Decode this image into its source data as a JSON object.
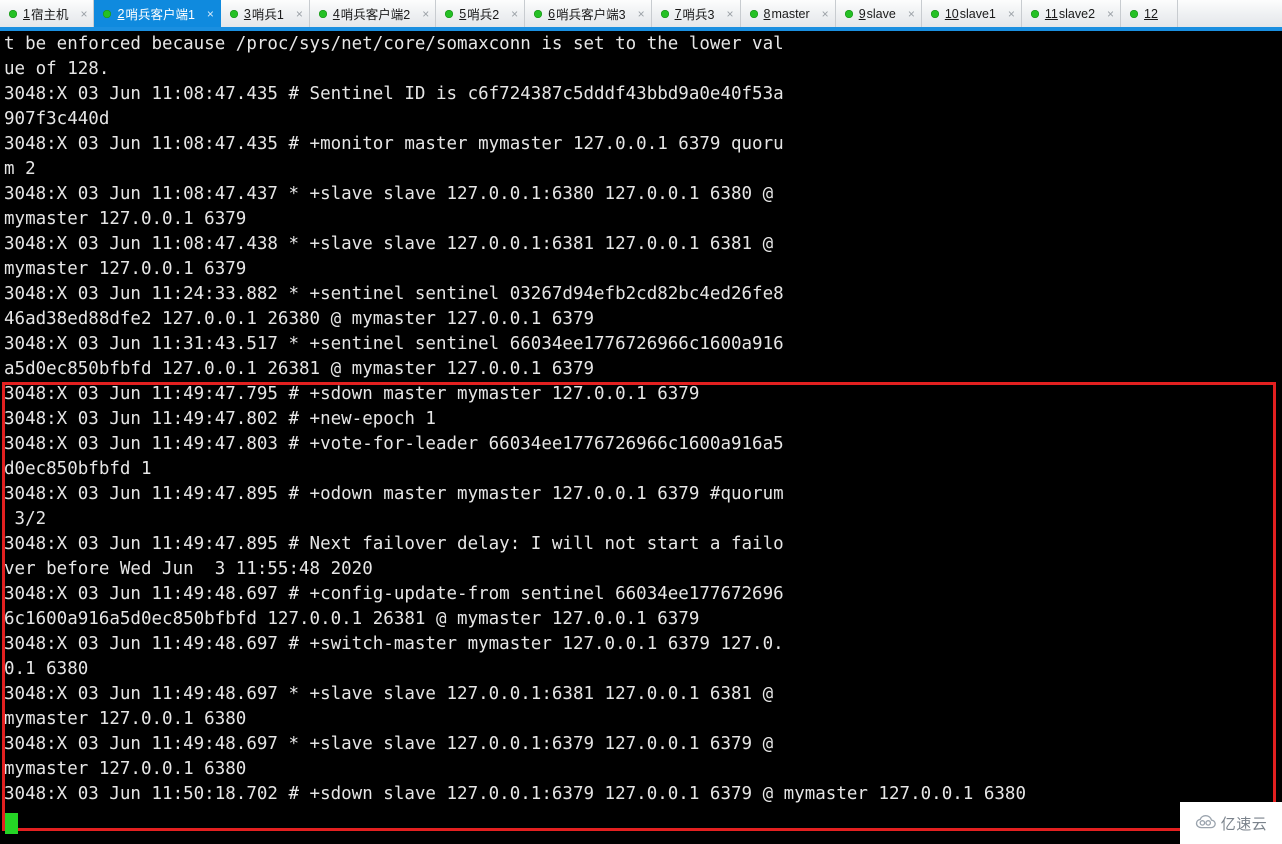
{
  "window": {
    "app": "Xshell",
    "accent_color": "#0f8ade",
    "tabbar_bg": "#f0f0f0",
    "terminal_bg": "#000000",
    "terminal_fg": "#e6e6e6",
    "cursor_color": "#25d425",
    "annotation_color": "#e32020"
  },
  "tabs": [
    {
      "index": "1",
      "label": "宿主机",
      "status": "connected",
      "active": false,
      "close": "×"
    },
    {
      "index": "2",
      "label": "哨兵客户端1",
      "status": "connected",
      "active": true,
      "close": "×"
    },
    {
      "index": "3",
      "label": "哨兵1",
      "status": "connected",
      "active": false,
      "close": "×"
    },
    {
      "index": "4",
      "label": "哨兵客户端2",
      "status": "connected",
      "active": false,
      "close": "×"
    },
    {
      "index": "5",
      "label": "哨兵2",
      "status": "connected",
      "active": false,
      "close": "×"
    },
    {
      "index": "6",
      "label": "哨兵客户端3",
      "status": "connected",
      "active": false,
      "close": "×"
    },
    {
      "index": "7",
      "label": "哨兵3",
      "status": "connected",
      "active": false,
      "close": "×"
    },
    {
      "index": "8",
      "label": "master",
      "status": "connected",
      "active": false,
      "close": "×"
    },
    {
      "index": "9",
      "label": "slave",
      "status": "connected",
      "active": false,
      "close": "×"
    },
    {
      "index": "10",
      "label": "slave1",
      "status": "connected",
      "active": false,
      "close": "×"
    },
    {
      "index": "11",
      "label": "slave2",
      "status": "connected",
      "active": false,
      "close": "×"
    },
    {
      "index": "12",
      "label": "",
      "status": "connected",
      "active": false,
      "close": ""
    }
  ],
  "terminal": {
    "lines": [
      "t be enforced because /proc/sys/net/core/somaxconn is set to the lower val",
      "ue of 128.",
      "3048:X 03 Jun 11:08:47.435 # Sentinel ID is c6f724387c5dddf43bbd9a0e40f53a",
      "907f3c440d",
      "3048:X 03 Jun 11:08:47.435 # +monitor master mymaster 127.0.0.1 6379 quoru",
      "m 2",
      "3048:X 03 Jun 11:08:47.437 * +slave slave 127.0.0.1:6380 127.0.0.1 6380 @",
      "mymaster 127.0.0.1 6379",
      "3048:X 03 Jun 11:08:47.438 * +slave slave 127.0.0.1:6381 127.0.0.1 6381 @",
      "mymaster 127.0.0.1 6379",
      "3048:X 03 Jun 11:24:33.882 * +sentinel sentinel 03267d94efb2cd82bc4ed26fe8",
      "46ad38ed88dfe2 127.0.0.1 26380 @ mymaster 127.0.0.1 6379",
      "3048:X 03 Jun 11:31:43.517 * +sentinel sentinel 66034ee1776726966c1600a916",
      "a5d0ec850bfbfd 127.0.0.1 26381 @ mymaster 127.0.0.1 6379",
      "3048:X 03 Jun 11:49:47.795 # +sdown master mymaster 127.0.0.1 6379",
      "3048:X 03 Jun 11:49:47.802 # +new-epoch 1",
      "3048:X 03 Jun 11:49:47.803 # +vote-for-leader 66034ee1776726966c1600a916a5",
      "d0ec850bfbfd 1",
      "3048:X 03 Jun 11:49:47.895 # +odown master mymaster 127.0.0.1 6379 #quorum",
      " 3/2",
      "3048:X 03 Jun 11:49:47.895 # Next failover delay: I will not start a failo",
      "ver before Wed Jun  3 11:55:48 2020",
      "3048:X 03 Jun 11:49:48.697 # +config-update-from sentinel 66034ee177672696",
      "6c1600a916a5d0ec850bfbfd 127.0.0.1 26381 @ mymaster 127.0.0.1 6379",
      "3048:X 03 Jun 11:49:48.697 # +switch-master mymaster 127.0.0.1 6379 127.0.",
      "0.1 6380",
      "3048:X 03 Jun 11:49:48.697 * +slave slave 127.0.0.1:6381 127.0.0.1 6381 @",
      "mymaster 127.0.0.1 6380",
      "3048:X 03 Jun 11:49:48.697 * +slave slave 127.0.0.1:6379 127.0.0.1 6379 @",
      "mymaster 127.0.0.1 6380",
      "3048:X 03 Jun 11:50:18.702 # +sdown slave 127.0.0.1:6379 127.0.0.1 6379 @ mymaster 127.0.0.1 6380"
    ],
    "highlight_start_line": 14,
    "highlight_end_line": 30
  },
  "watermark": {
    "logo": "cloud-icon",
    "text": "亿速云"
  }
}
